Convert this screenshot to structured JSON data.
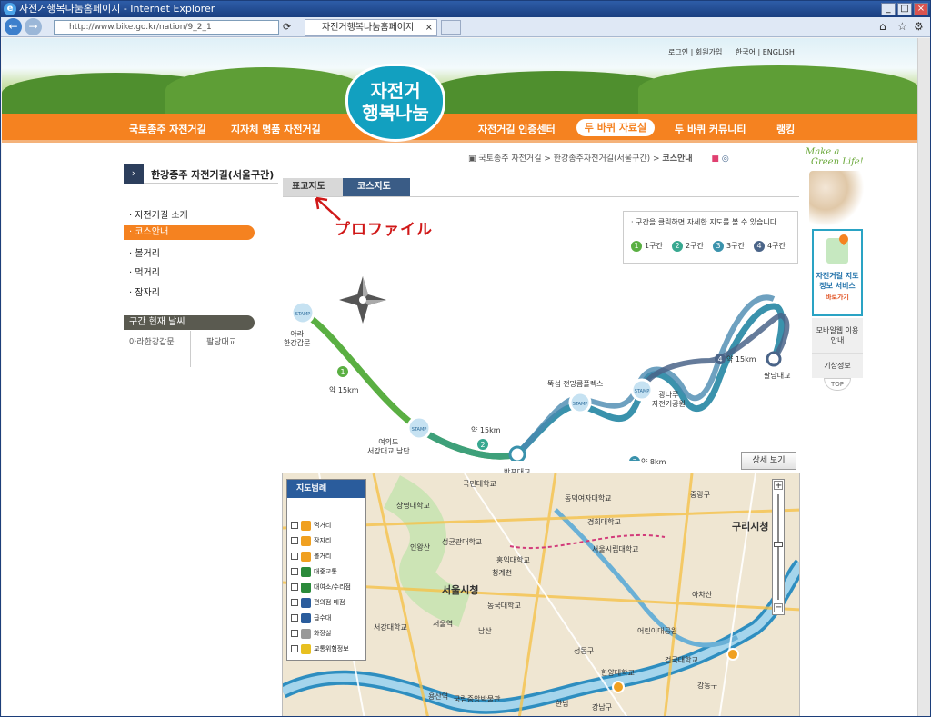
{
  "window": {
    "title": "자전거행복나눔홈페이지 - Internet Explorer",
    "url": "http://www.bike.go.kr/nation/9_2_1",
    "tab_title": "자전거행복나눔홈페이지"
  },
  "header": {
    "util": [
      "로그인",
      "회원가입",
      "한국어",
      "ENGLISH"
    ],
    "logo_line1": "자전거",
    "logo_line2": "행복나눔"
  },
  "menu": {
    "items": [
      "국토종주 자전거길",
      "지자체 명품 자전거길",
      "자전거길 인증센터",
      "두 바퀴 자료실",
      "두 바퀴 커뮤니티",
      "랭킹"
    ],
    "active": "두 바퀴 자료실"
  },
  "breadcrumb": [
    "국토종주 자전거길",
    "한강종주자전거길(서울구간)",
    "코스안내"
  ],
  "section_title": "한강종주 자전거길(서울구간)",
  "sidebar": {
    "items": [
      "자전거길 소개",
      "코스안내",
      "볼거리",
      "먹거리",
      "잠자리"
    ],
    "active_index": 1,
    "weather_title": "구간 현재 날씨",
    "weather_places": [
      "아라한강갑문",
      "팔당대교"
    ]
  },
  "map_tabs": {
    "tab1": "표고지도",
    "tab2": "코스지도"
  },
  "annotation": {
    "text": "プロファイル"
  },
  "route_legend": {
    "note": "구간을 클릭하면 자세한 지도를 볼 수 있습니다.",
    "sections": [
      {
        "num": "1",
        "label": "1구간",
        "color": "#5aaf42"
      },
      {
        "num": "2",
        "label": "2구간",
        "color": "#38a890"
      },
      {
        "num": "3",
        "label": "3구간",
        "color": "#3a92ac"
      },
      {
        "num": "4",
        "label": "4구간",
        "color": "#4a6488"
      }
    ]
  },
  "route": {
    "stops": [
      {
        "name_line1": "아라",
        "name_line2": "한강갑문"
      },
      {
        "name_line1": "여의도",
        "name_line2": "서강대교 남단"
      },
      {
        "name_line1": "반포대교",
        "name_line2": ""
      },
      {
        "name_line1": "뚝섬 전망콤플렉스",
        "name_line2": ""
      },
      {
        "name_line1": "광나루",
        "name_line2": "자전거공원"
      },
      {
        "name_line1": "팔당대교",
        "name_line2": ""
      }
    ],
    "distances": [
      "약 15km",
      "약 15km",
      "약 8km",
      "약 15km"
    ],
    "stamp": "STAMP"
  },
  "detail_button": "상세 보기",
  "map": {
    "legend_title": "지도범례",
    "legend_items": [
      {
        "label": "먹거리",
        "color": "#f0a020"
      },
      {
        "label": "잠자리",
        "color": "#f0a020"
      },
      {
        "label": "볼거리",
        "color": "#f0a020"
      },
      {
        "label": "대중교통",
        "color": "#2a8a3a"
      },
      {
        "label": "대여소/수리점",
        "color": "#2a8a3a"
      },
      {
        "label": "편의점 매점",
        "color": "#2a5c9c"
      },
      {
        "label": "급수대",
        "color": "#2a5c9c"
      },
      {
        "label": "화장실",
        "color": "#999999"
      },
      {
        "label": "교통위험정보",
        "color": "#e8c020"
      }
    ],
    "labels": [
      "국민대학교",
      "상명대학교",
      "성균관대학교",
      "동덕여자대학교",
      "경희대학교",
      "서울시립대학교",
      "인왕산",
      "청계천",
      "중랑구",
      "구리시청",
      "서울시청",
      "동국대학교",
      "아차산",
      "어린이대공원",
      "서울역",
      "남산",
      "서강대학교",
      "국립중앙박물관",
      "한남",
      "강남구",
      "강동구",
      "용산역",
      "성동구",
      "홍익대학교",
      "건국대학교",
      "한양대학교"
    ]
  },
  "right_rail": {
    "slogan1": "Make a",
    "slogan2": "Green Life!",
    "service_title": "자전거길 지도정보 서비스",
    "service_go": "바로가기",
    "mobile": "모바일웹 이용안내",
    "weather": "기상정보",
    "top": "TOP"
  }
}
